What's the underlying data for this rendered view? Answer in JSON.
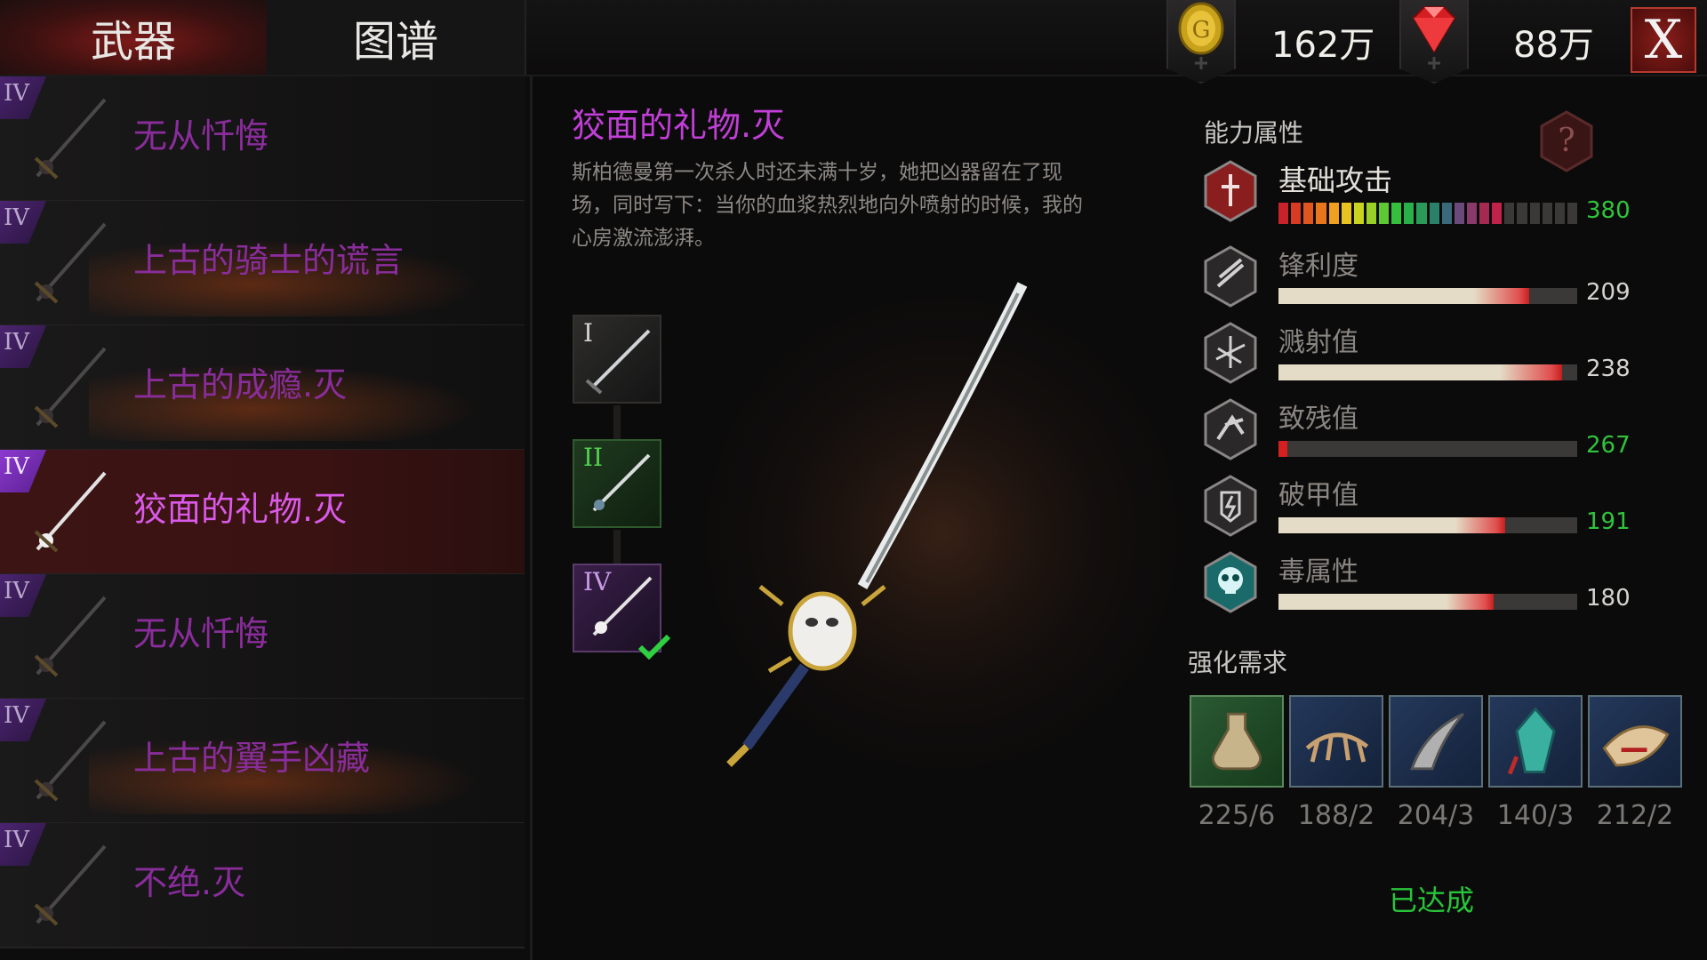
{
  "tabs": {
    "weapons": "武器",
    "codex": "图谱"
  },
  "currency": {
    "gold": "162万",
    "gems": "88万"
  },
  "close_label": "X",
  "weapon_list": [
    {
      "tier": "IV",
      "name": "无从忏悔"
    },
    {
      "tier": "IV",
      "name": "上古的骑士的谎言"
    },
    {
      "tier": "IV",
      "name": "上古的成瘾.灭"
    },
    {
      "tier": "IV",
      "name": "狡面的礼物.灭",
      "selected": true
    },
    {
      "tier": "IV",
      "name": "无从忏悔"
    },
    {
      "tier": "IV",
      "name": "上古的翼手凶藏"
    },
    {
      "tier": "IV",
      "name": "不绝.灭"
    }
  ],
  "detail": {
    "name": "狡面的礼物.灭",
    "description": "斯柏德曼第一次杀人时还未满十岁，她把凶器留在了现场，同时写下：当你的血浆热烈地向外喷射的时候，我的心房激流澎湃。",
    "stages": [
      {
        "label": "I",
        "color": "#d4d4d4"
      },
      {
        "label": "II",
        "color": "#4fd04f"
      },
      {
        "label": "IV",
        "color": "#c99be8"
      }
    ]
  },
  "attributes": {
    "title": "能力属性",
    "stats": [
      {
        "name": "基础攻击",
        "value": "380",
        "fill": 0.76,
        "color": "#2fc43c",
        "icon": "attack-icon"
      },
      {
        "name": "锋利度",
        "value": "209",
        "fill": 0.84,
        "color": "#d6d4d0",
        "icon": "sharpness-icon"
      },
      {
        "name": "溅射值",
        "value": "238",
        "fill": 0.95,
        "color": "#d6d4d0",
        "icon": "splash-icon"
      },
      {
        "name": "致残值",
        "value": "267",
        "fill": 0.03,
        "color": "#2fc43c",
        "icon": "cripple-icon"
      },
      {
        "name": "破甲值",
        "value": "191",
        "fill": 0.76,
        "color": "#2fc43c",
        "icon": "armor-break-icon"
      },
      {
        "name": "毒属性",
        "value": "180",
        "fill": 0.72,
        "color": "#d6d4d0",
        "icon": "poison-skull-icon"
      }
    ]
  },
  "requirements": {
    "title": "强化需求",
    "materials": [
      {
        "count": "225/6",
        "icon": "potion-flask-icon"
      },
      {
        "count": "188/2",
        "icon": "claw-icon"
      },
      {
        "count": "204/3",
        "icon": "fang-icon"
      },
      {
        "count": "140/3",
        "icon": "crystal-icon"
      },
      {
        "count": "212/2",
        "icon": "bone-icon"
      }
    ],
    "status": "已达成"
  }
}
